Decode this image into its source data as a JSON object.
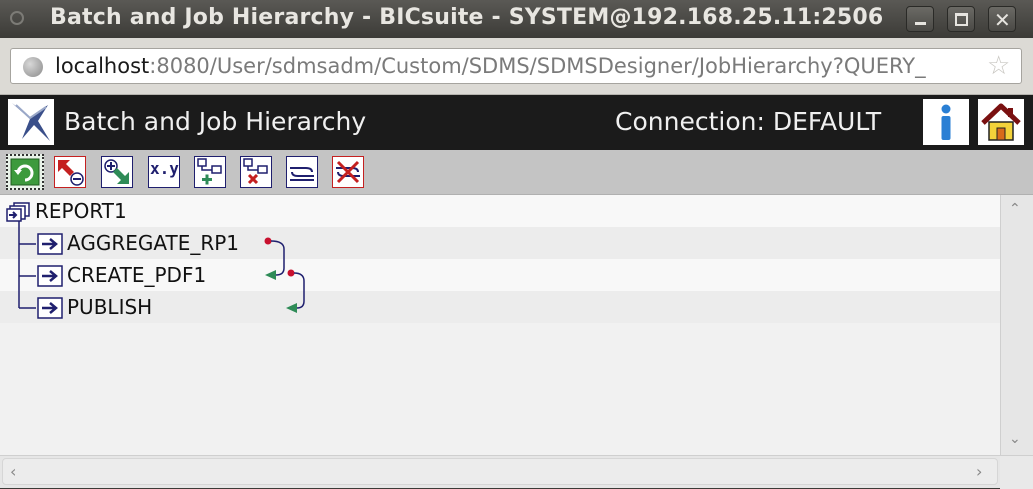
{
  "window": {
    "title": "Batch and Job Hierarchy - BICsuite - SYSTEM@192.168.25.11:2506"
  },
  "browser": {
    "url_host": "localhost",
    "url_rest": ":8080/User/sdmsadm/Custom/SDMS/SDMSDesigner/JobHierarchy?QUERY_"
  },
  "app": {
    "title": "Batch and Job Hierarchy",
    "connection_text": "Connection:  DEFAULT"
  },
  "toolbar": {
    "buttons": [
      {
        "name": "refresh",
        "icon": "refresh-icon"
      },
      {
        "name": "collapse",
        "icon": "collapse-icon"
      },
      {
        "name": "expand",
        "icon": "expand-icon"
      },
      {
        "name": "xy",
        "icon": "xy-icon",
        "label": "x.y"
      },
      {
        "name": "add-child",
        "icon": "add-child-icon"
      },
      {
        "name": "remove-child",
        "icon": "remove-child-icon"
      },
      {
        "name": "dependency",
        "icon": "dependency-icon"
      },
      {
        "name": "delete",
        "icon": "delete-icon"
      }
    ]
  },
  "tree": {
    "root": {
      "label": "REPORT1",
      "icon": "batch-icon"
    },
    "children": [
      {
        "label": "AGGREGATE_RP1",
        "icon": "job-icon"
      },
      {
        "label": "CREATE_PDF1",
        "icon": "job-icon"
      },
      {
        "label": "PUBLISH",
        "icon": "job-icon"
      }
    ]
  },
  "colors": {
    "header_bg": "#1b1b1b",
    "toolbar_bg": "#c4c4c4",
    "dependency_start": "#c8102e",
    "dependency_end": "#2e8b57",
    "job_icon": "#1f1f6e"
  }
}
